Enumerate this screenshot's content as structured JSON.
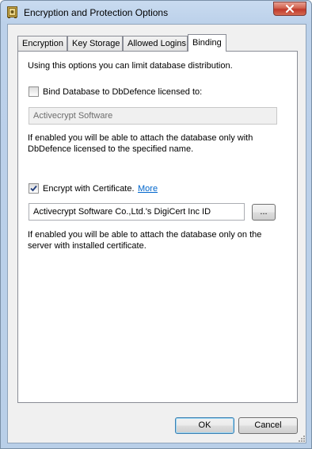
{
  "window": {
    "title": "Encryption and Protection Options",
    "icons": {
      "app": "safe-icon",
      "close": "close-icon"
    }
  },
  "tabs": [
    {
      "label": "Encryption",
      "active": false
    },
    {
      "label": "Key Storage",
      "active": false
    },
    {
      "label": "Allowed Logins",
      "active": false
    },
    {
      "label": "Binding",
      "active": true
    }
  ],
  "binding": {
    "intro": "Using this options you can limit database distribution.",
    "bind_checkbox": {
      "label": "Bind Database to DbDefence licensed to:",
      "checked": false
    },
    "licensee_value": "Activecrypt Software",
    "bind_help": "If enabled you will be able to attach the database only with DbDefence licensed to the specified name.",
    "cert_checkbox": {
      "label": "Encrypt with Certificate.",
      "checked": true
    },
    "more_link": "More",
    "certificate_value": "Activecrypt Software Co.,Ltd.'s DigiCert Inc ID",
    "browse_label": "...",
    "cert_help": "If enabled you will be able to attach the database only on the server with installed certificate."
  },
  "buttons": {
    "ok": "OK",
    "cancel": "Cancel"
  }
}
